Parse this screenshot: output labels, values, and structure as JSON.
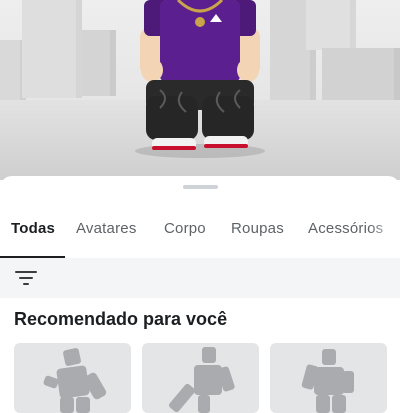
{
  "tabs": [
    {
      "label": "Todas",
      "active": true
    },
    {
      "label": "Avatares",
      "active": false
    },
    {
      "label": "Corpo",
      "active": false
    },
    {
      "label": "Roupas",
      "active": false
    },
    {
      "label": "Acessórios",
      "active": false
    }
  ],
  "filter": {
    "icon": "filter-icon"
  },
  "recommended": {
    "title": "Recomendado para você",
    "cards": [
      {
        "icon": "avatar-pose-icon"
      },
      {
        "icon": "avatar-pose-icon"
      },
      {
        "icon": "avatar-pose-icon"
      }
    ]
  },
  "colors": {
    "accent": "#1c1f22",
    "shirt": "#5b1f8f",
    "pants": "#2a2a2a"
  }
}
